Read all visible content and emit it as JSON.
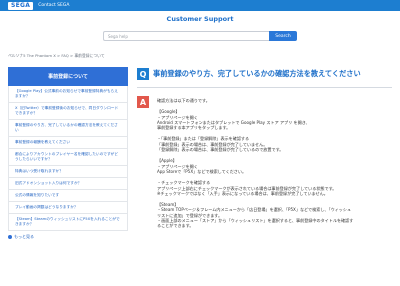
{
  "header": {
    "logo": "SEGA",
    "contact": "Contact SEGA"
  },
  "support_title": "Customer Support",
  "search": {
    "placeholder": "Sega help",
    "button": "Search"
  },
  "breadcrumb": "ペルソナ5 The Phantom X  >  FAQ  >  事前登録について",
  "sidebar": {
    "heading": "事前登録について",
    "items": [
      "【Google Play】公式事前のお知らせで事前登録特典がもらえますか？",
      "X（旧Twitter）で事前登録後のお知らせで、同日ダウンロードできますか？",
      "事前登録のやり方、完了しているかの確認方法を教えてください",
      "事前登録の報酬を教えてください",
      "都合によりアカウントのプレイヤー名を確認したいのですがどうしたらいいですか？",
      "特典はいつ受け取れますか？",
      "旧式アドオンショット入りは何ですか？",
      "公式の情報を知りたいです",
      "プレイ動画の掲載はどうなりますか？",
      "【Steam】SteamのウィッシュリストにP5Xを入れることができますか？"
    ],
    "more": "もっと見る"
  },
  "question": {
    "badge": "Q",
    "title": "事前登録のやり方、完了しているかの確認方法を教えてください"
  },
  "answer": {
    "badge": "A",
    "lines": [
      "確認方法は以下の通りです。",
      "",
      "【Google】",
      "・アプリページを開く",
      "Android スマートフォンまたはタブレットで Google Play ストア アプリ を開き、",
      "事前登録する本アプリをタップします。",
      "",
      "・「事前登録」または「登録解除」表示を確認する",
      "「事前登録」表示の場合は、事前登録が完了していません。",
      "「登録解除」表示の場合は、事前登録が完了しているので放置です。",
      "",
      "【Apple】",
      "・アプリページを開く",
      "App Storeで「P5X」などで検索してください。",
      "",
      "・チェックマークを確認する",
      "アプリページ上部右にチェックマークが表示されている場合は事前登録が完了している状態です。",
      "※チェックマークではなく「入手」表示になっている場合は、事前登録が完了していません。",
      "",
      "【Steam】",
      "・Steam TOPページ＆フレーム内メニューから「店日登場」を選択、「P5X」などで検索し、「ウィッシュ",
      "リストに追加」で登録ができます。",
      "・画面上部のメニュー「ストア」から「ウィッシュリスト」を選択すると、事前登録中のタイトルを確認す",
      "ることができます。"
    ]
  }
}
